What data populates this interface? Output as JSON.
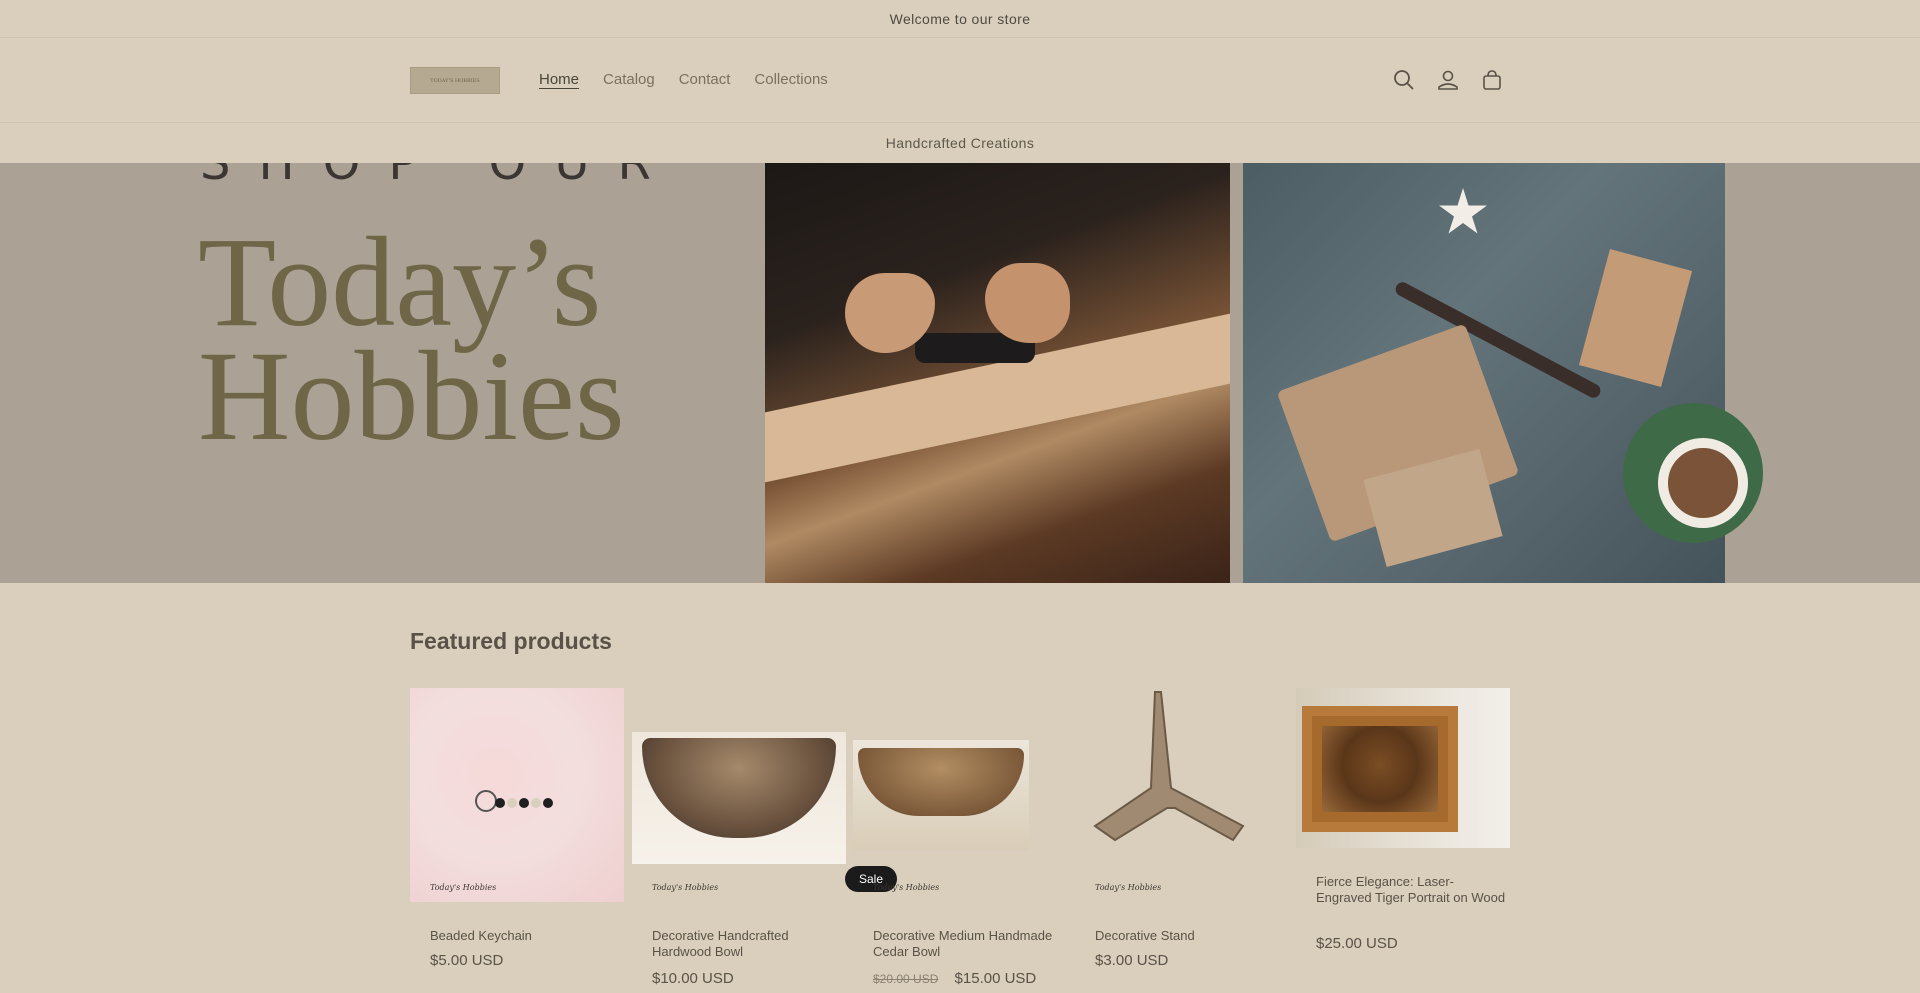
{
  "announcement": "Welcome to our store",
  "header": {
    "logo_text": "TODAY'S HOBBIES",
    "nav": [
      "Home",
      "Catalog",
      "Contact",
      "Collections"
    ],
    "active": "Home"
  },
  "subbar": "Handcrafted Creations",
  "hero": {
    "eyebrow": "SHOP OUR",
    "title_line1": "Today’s",
    "title_line2": "Hobbies"
  },
  "featured": {
    "heading": "Featured products",
    "brand_mark": "Today's Hobbies",
    "products": [
      {
        "title": "Beaded Keychain",
        "price": "$5.00 USD"
      },
      {
        "title": "Decorative Handcrafted Hardwood Bowl",
        "price": "$10.00 USD"
      },
      {
        "title": "Decorative Medium Handmade Cedar Bowl",
        "old_price": "$20.00 USD",
        "price": "$15.00 USD",
        "badge": "Sale"
      },
      {
        "title": "Decorative Stand",
        "price": "$3.00 USD"
      },
      {
        "title": "Fierce Elegance: Laser-Engraved Tiger Portrait on Wood",
        "price": "$25.00 USD"
      }
    ]
  },
  "colors": {
    "background": "#dacfbc",
    "hero_bg": "#aba295",
    "hero_title": "#6f6648"
  }
}
